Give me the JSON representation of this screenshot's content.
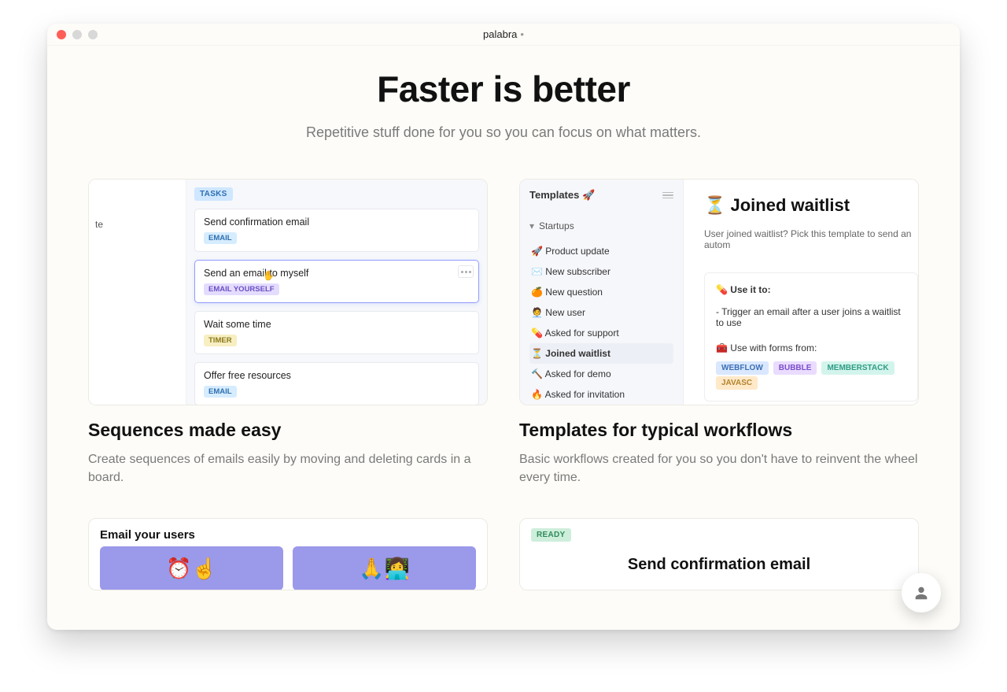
{
  "window": {
    "title": "palabra",
    "unsaved_dot": "•"
  },
  "hero": {
    "title": "Faster is better",
    "subtitle": "Repetitive stuff done for you so you can focus on what matters."
  },
  "features": [
    {
      "title": "Sequences made easy",
      "desc": "Create sequences of emails easily by moving and deleting cards in a board."
    },
    {
      "title": "Templates for typical workflows",
      "desc": "Basic workflows created for you so you don't have to reinvent the wheel every time."
    }
  ],
  "sequences": {
    "column_label": "TASKS",
    "left_peek": "te",
    "cards": [
      {
        "title": "Send confirmation email",
        "badge": "EMAIL",
        "cls": "b-email",
        "selected": false
      },
      {
        "title": "Send an email to myself",
        "badge": "EMAIL YOURSELF",
        "cls": "b-self",
        "selected": true
      },
      {
        "title": "Wait some time",
        "badge": "TIMER",
        "cls": "b-timer",
        "selected": false
      },
      {
        "title": "Offer free resources",
        "badge": "EMAIL",
        "cls": "b-email",
        "selected": false
      }
    ]
  },
  "templates": {
    "panel_title": "Templates 🚀",
    "group": "Startups",
    "items": [
      {
        "icon": "🚀",
        "label": "Product update"
      },
      {
        "icon": "✉️",
        "label": "New subscriber"
      },
      {
        "icon": "🍊",
        "label": "New question"
      },
      {
        "icon": "🧑‍💼",
        "label": "New user"
      },
      {
        "icon": "💊",
        "label": "Asked for support"
      },
      {
        "icon": "⏳",
        "label": "Joined waitlist",
        "active": true
      },
      {
        "icon": "🔨",
        "label": "Asked for demo"
      },
      {
        "icon": "🔥",
        "label": "Asked for invitation"
      }
    ],
    "detail": {
      "title": "⏳ Joined waitlist",
      "subtitle": "User joined waitlist? Pick this template to send an autom",
      "use_header": "💊 Use it to:",
      "use_line": "- Trigger an email after a user joins a waitlist to use",
      "forms_header": "🧰 Use with forms from:",
      "tags": [
        "WEBFLOW",
        "BUBBLE",
        "MEMBERSTACK",
        "JAVASC"
      ]
    }
  },
  "row2": {
    "email_users": {
      "title": "Email your users",
      "tiles": [
        "⏰☝️",
        "🙏👩‍💻"
      ]
    },
    "confirmation": {
      "ready_label": "READY",
      "title": "Send confirmation email"
    }
  }
}
